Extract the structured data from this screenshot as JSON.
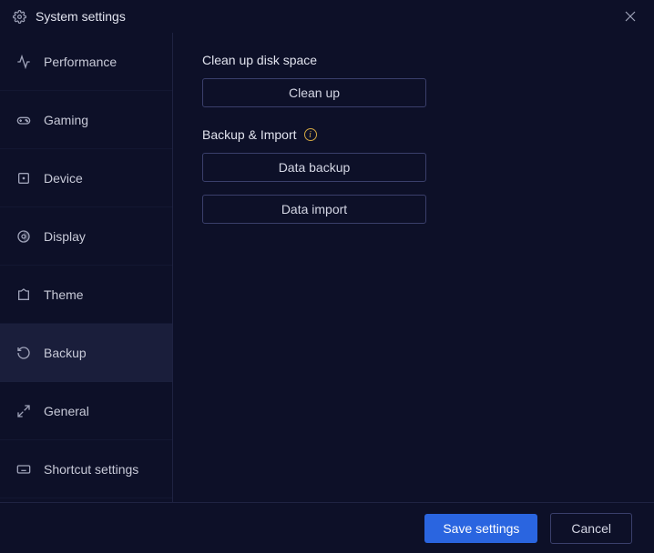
{
  "titlebar": {
    "title": "System settings"
  },
  "sidebar": {
    "items": [
      {
        "label": "Performance"
      },
      {
        "label": "Gaming"
      },
      {
        "label": "Device"
      },
      {
        "label": "Display"
      },
      {
        "label": "Theme"
      },
      {
        "label": "Backup"
      },
      {
        "label": "General"
      },
      {
        "label": "Shortcut settings"
      }
    ],
    "active_index": 5
  },
  "content": {
    "cleanup": {
      "title": "Clean up disk space",
      "button": "Clean up"
    },
    "backup": {
      "title": "Backup & Import",
      "backup_button": "Data backup",
      "import_button": "Data import"
    }
  },
  "footer": {
    "save": "Save settings",
    "cancel": "Cancel"
  }
}
